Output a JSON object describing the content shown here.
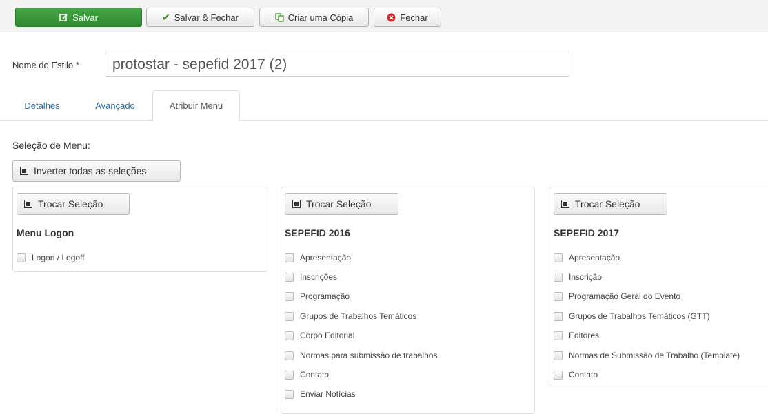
{
  "toolbar": {
    "save": "Salvar",
    "save_close": "Salvar & Fechar",
    "copy": "Criar uma Cópia",
    "close": "Fechar"
  },
  "style_name": {
    "label": "Nome do Estilo *",
    "value": "protostar - sepefid 2017 (2)"
  },
  "tabs": [
    "Detalhes",
    "Avançado",
    "Atribuir Menu"
  ],
  "menu_selection_label": "Seleção de Menu:",
  "invert_all": "Inverter todas as seleções",
  "toggle_label": "Trocar Seleção",
  "menus": [
    {
      "title": "Menu Logon",
      "items": [
        "Logon / Logoff"
      ]
    },
    {
      "title": "SEPEFID 2016",
      "items": [
        "Apresentação",
        "Inscrições",
        "Programação",
        "Grupos de Trabalhos Temáticos",
        "Corpo Editorial",
        "Normas para submissão de trabalhos",
        "Contato",
        "Enviar Notícias"
      ]
    },
    {
      "title": "SEPEFID 2017",
      "items": [
        "Apresentação",
        "Inscrição",
        "Programação Geral do Evento",
        "Grupos de Trabalhos Temáticos (GTT)",
        "Editores",
        "Normas de Submissão de Trabalho (Template)",
        "Contato"
      ]
    }
  ]
}
